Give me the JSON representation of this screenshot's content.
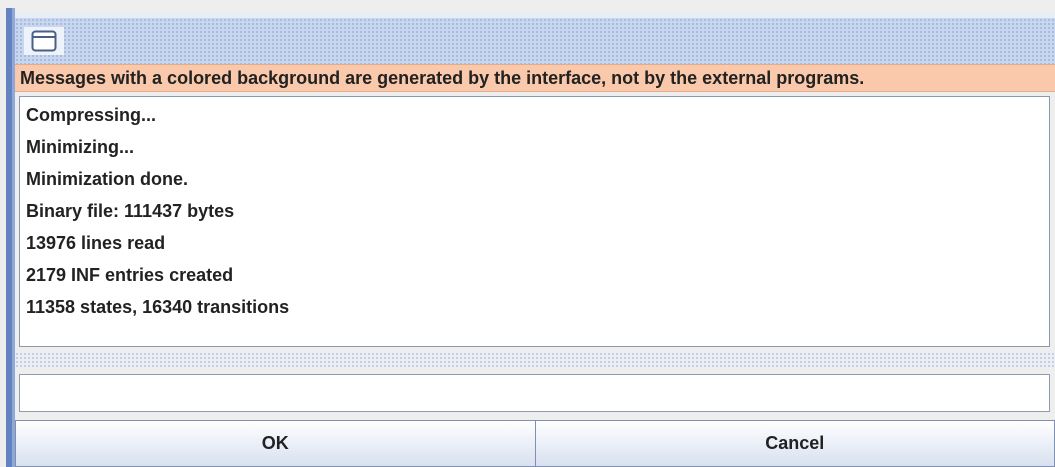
{
  "window": {
    "title": "",
    "title_icon": "window-icon"
  },
  "banner": {
    "text": "Messages with a colored background are generated by the interface, not by the external programs.",
    "background_color": "#fac8aa"
  },
  "log": {
    "lines": [
      "Compressing...",
      "Minimizing...",
      "Minimization done.",
      "Binary file: 111437 bytes",
      "13976 lines read",
      "2179 INF entries created",
      "11358 states, 16340 transitions"
    ]
  },
  "input": {
    "value": "",
    "placeholder": ""
  },
  "buttons": {
    "ok_label": "OK",
    "cancel_label": "Cancel"
  }
}
